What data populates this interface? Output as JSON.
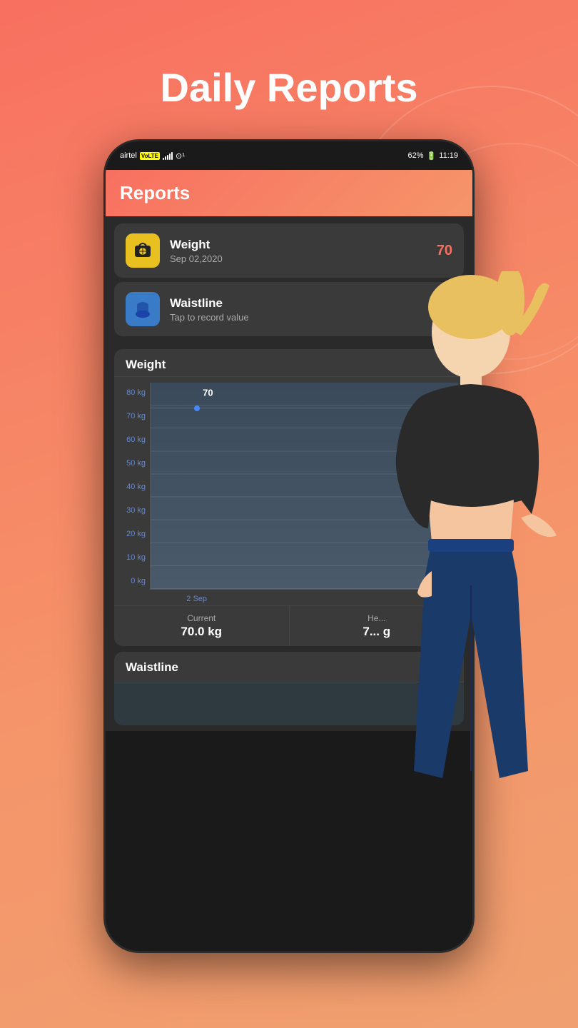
{
  "page": {
    "title": "Daily Reports",
    "bg_color": "#f87060"
  },
  "status_bar": {
    "carrier": "airtel",
    "volte": "VoLTE",
    "battery": "62%",
    "time": "11:19"
  },
  "app_header": {
    "title": "Reports"
  },
  "report_cards": [
    {
      "id": "weight",
      "title": "Weight",
      "subtitle": "Sep 02,2020",
      "value": "70",
      "icon": "⚖️",
      "icon_bg": "weight"
    },
    {
      "id": "waistline",
      "title": "Waistline",
      "subtitle": "Tap to record value",
      "value": "",
      "icon": "👗",
      "icon_bg": "waist"
    }
  ],
  "weight_chart": {
    "title": "Weight",
    "y_labels": [
      "80 kg",
      "70 kg",
      "60 kg",
      "50 kg",
      "40 kg",
      "30 kg",
      "20 kg",
      "10 kg",
      "0 kg"
    ],
    "x_labels": [
      "2 Sep"
    ],
    "data_point_label": "70",
    "data_point_value": 70,
    "y_max": 80,
    "y_min": 0,
    "stats": [
      {
        "label": "Current",
        "value": "70.0  kg"
      },
      {
        "label": "He...",
        "value": "7... g"
      }
    ]
  },
  "waistline_chart": {
    "title": "Waistline"
  }
}
